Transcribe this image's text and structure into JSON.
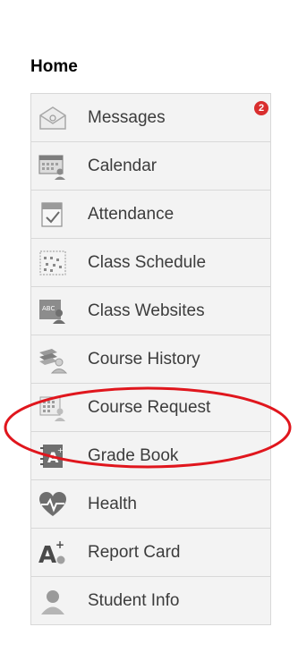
{
  "header": {
    "title": "Home"
  },
  "menu": {
    "items": [
      {
        "label": "Messages",
        "icon": "envelope-icon",
        "badge": "2"
      },
      {
        "label": "Calendar",
        "icon": "calendar-icon"
      },
      {
        "label": "Attendance",
        "icon": "attendance-check-icon"
      },
      {
        "label": "Class Schedule",
        "icon": "schedule-grid-icon"
      },
      {
        "label": "Class Websites",
        "icon": "class-websites-icon"
      },
      {
        "label": "Course History",
        "icon": "books-user-icon"
      },
      {
        "label": "Course Request",
        "icon": "course-request-icon"
      },
      {
        "label": "Grade Book",
        "icon": "grade-book-icon"
      },
      {
        "label": "Health",
        "icon": "heart-pulse-icon"
      },
      {
        "label": "Report Card",
        "icon": "report-card-grade-icon"
      },
      {
        "label": "Student Info",
        "icon": "student-user-icon"
      }
    ]
  },
  "colors": {
    "badge": "#d92e2e",
    "annotation": "#e0161d",
    "icon_gray": "#8a8a8a"
  }
}
